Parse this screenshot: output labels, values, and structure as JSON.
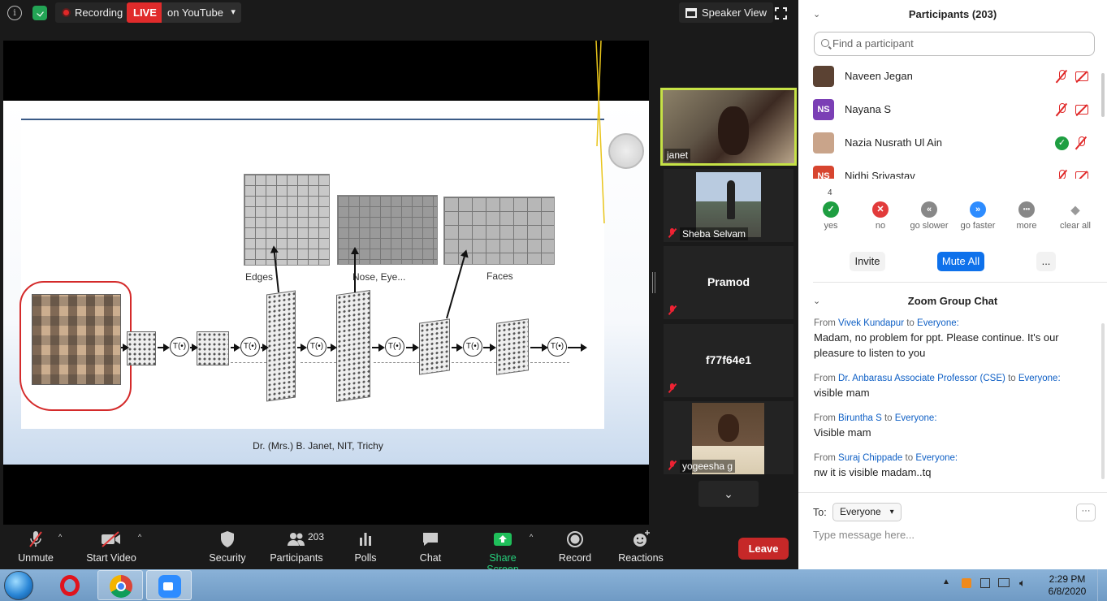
{
  "topbar": {
    "recording_label": "Recording",
    "live_badge": "LIVE",
    "live_target": "on YouTube",
    "view_label": "Speaker View"
  },
  "slide": {
    "footer": "Dr. (Mrs.) B. Janet, NIT, Trichy",
    "labels": {
      "edges": "Edges",
      "nose_eye": "Nose, Eye...",
      "faces": "Faces"
    },
    "t_node": "T(•)"
  },
  "video_tiles": [
    {
      "name": "janet",
      "active_speaker": true,
      "muted": false
    },
    {
      "name": "Sheba Selvam",
      "muted": true
    },
    {
      "name": "Pramod",
      "muted": true
    },
    {
      "name": "f77f64e1",
      "muted": true
    },
    {
      "name": "yogeesha g",
      "muted": true
    }
  ],
  "toolbar": {
    "unmute": "Unmute",
    "start_video": "Start Video",
    "security": "Security",
    "participants": "Participants",
    "participants_count": "203",
    "polls": "Polls",
    "chat": "Chat",
    "share_screen": "Share Screen",
    "record": "Record",
    "reactions": "Reactions",
    "leave": "Leave"
  },
  "participants_panel": {
    "title": "Participants (203)",
    "search_placeholder": "Find a participant",
    "participants": [
      {
        "name": "Naveen Jegan",
        "initials": "",
        "avatar_color": "#5b4233",
        "status": "mic-muted"
      },
      {
        "name": "Nayana S",
        "initials": "NS",
        "avatar_color": "#7b3fb5",
        "status": "mic-muted"
      },
      {
        "name": "Nazia Nusrath Ul Ain",
        "initials": "",
        "avatar_color": "#c9a48a",
        "status": "yes"
      },
      {
        "name": "Nidhi Srivastav",
        "initials": "NS",
        "avatar_color": "#d7452f",
        "status": "mic-muted"
      }
    ],
    "reactions": [
      {
        "label": "yes",
        "count": "4",
        "color": "#1e9e41",
        "symbol": "✓"
      },
      {
        "label": "no",
        "color": "#e23b3b",
        "symbol": "✕"
      },
      {
        "label": "go slower",
        "color": "#888888",
        "symbol": "«"
      },
      {
        "label": "go faster",
        "color": "#2d8cff",
        "symbol": "»"
      },
      {
        "label": "more",
        "color": "#888888",
        "symbol": "•••"
      },
      {
        "label": "clear all",
        "color": "#888888",
        "symbol": "◆"
      }
    ],
    "invite": "Invite",
    "mute_all": "Mute All",
    "more": "..."
  },
  "chat": {
    "title": "Zoom Group Chat",
    "from_word": "From",
    "to_word": "to",
    "messages": [
      {
        "from": "Vivek Kundapur",
        "to": "Everyone:",
        "text": "Madam, no problem for ppt. Please continue. It's our pleasure to listen to you"
      },
      {
        "from": "Dr. Anbarasu Associate Professor (CSE)",
        "to": "Everyone:",
        "text": "visible mam"
      },
      {
        "from": "Biruntha S",
        "to": "Everyone:",
        "text": "Visible mam"
      },
      {
        "from": "Suraj Chippade",
        "to": "Everyone:",
        "text": "nw it is visible madam..tq"
      }
    ],
    "to_label": "To:",
    "to_value": "Everyone",
    "input_placeholder": "Type message here..."
  },
  "taskbar": {
    "time": "2:29 PM",
    "date": "6/8/2020"
  }
}
